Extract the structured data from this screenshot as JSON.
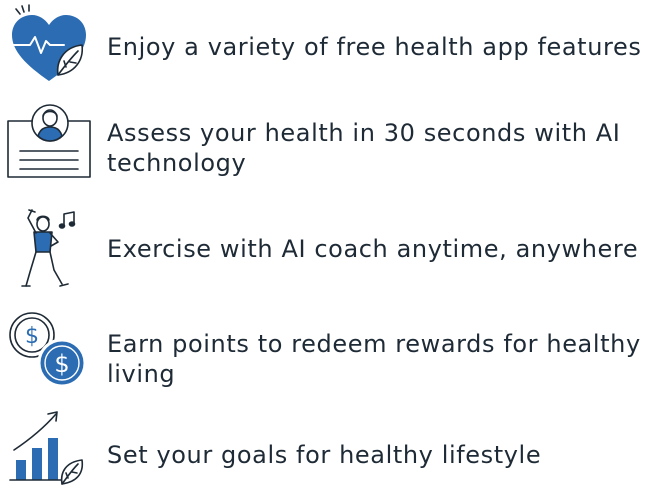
{
  "accent_color": "#2b6cb3",
  "line_color": "#1e2a35",
  "features": [
    {
      "icon": "heart-health-icon",
      "text": "Enjoy a variety of free health app features"
    },
    {
      "icon": "health-id-card-icon",
      "text": "Assess your health in 30 seconds with AI technology"
    },
    {
      "icon": "exercise-person-icon",
      "text": "Exercise with AI coach anytime, anywhere"
    },
    {
      "icon": "reward-coins-icon",
      "text": "Earn points to redeem rewards for healthy living"
    },
    {
      "icon": "growth-chart-icon",
      "text": "Set your goals for healthy lifestyle"
    }
  ]
}
